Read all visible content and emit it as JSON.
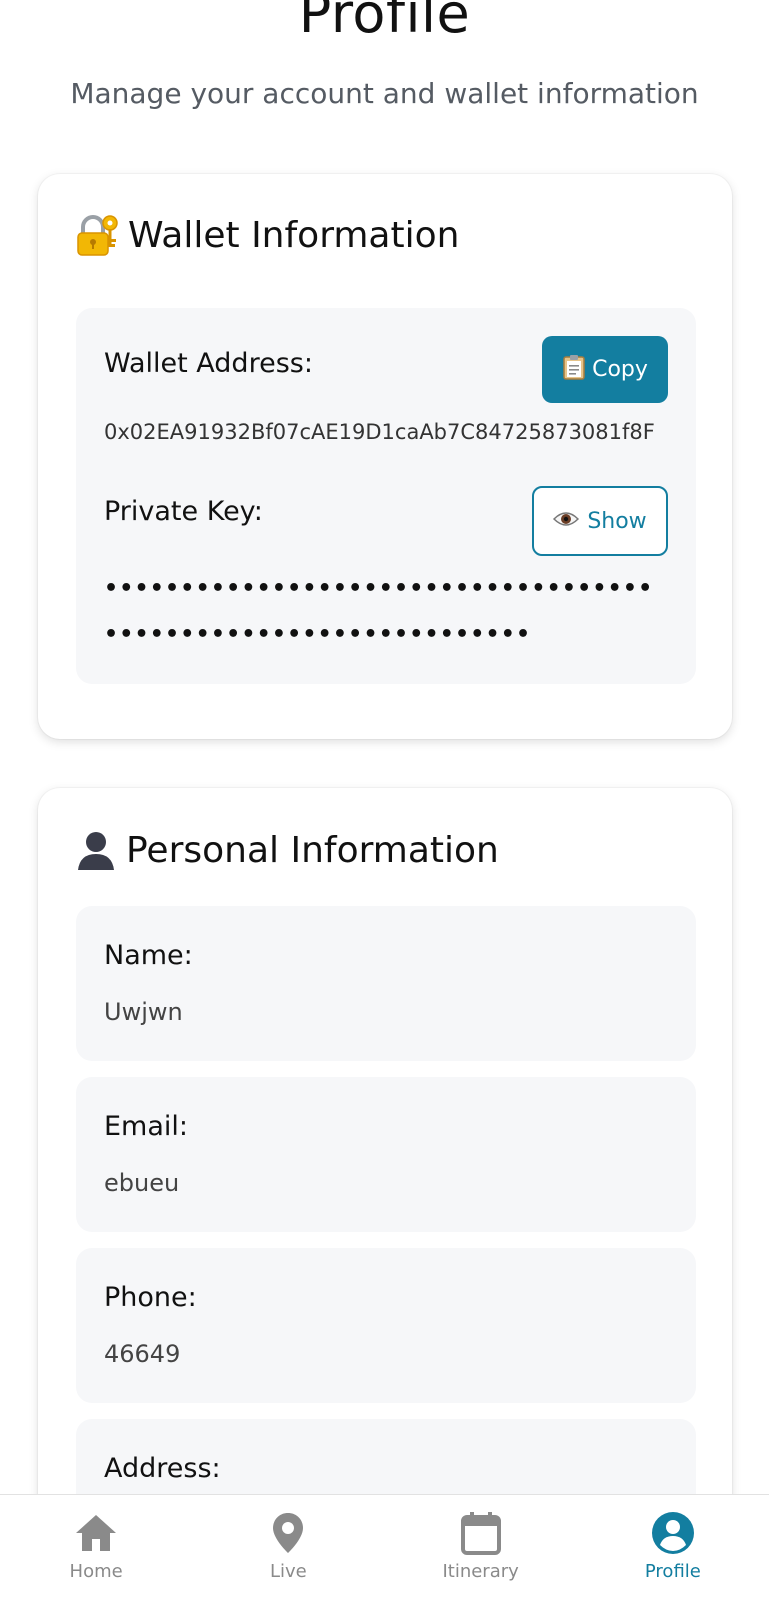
{
  "header": {
    "title": "Profile",
    "subtitle": "Manage your account and wallet information"
  },
  "wallet": {
    "title": "Wallet Information",
    "icon": "lock-with-key-icon",
    "address_label": "Wallet Address:",
    "address_value": "0x02EA91932Bf07cAE19D1caAb7C84725873081f8F",
    "copy_button": "Copy",
    "private_key_label": "Private Key:",
    "show_button": "Show",
    "private_key_masked": "••••••••••••••••••••••••••••••••••••••••••••••••••••••••••••••••"
  },
  "personal": {
    "title": "Personal Information",
    "icon": "person-silhouette-icon",
    "fields": [
      {
        "label": "Name:",
        "value": "Uwjwn"
      },
      {
        "label": "Email:",
        "value": "ebueu"
      },
      {
        "label": "Phone:",
        "value": "46649"
      },
      {
        "label": "Address:",
        "value": ""
      }
    ]
  },
  "nav": {
    "items": [
      {
        "label": "Home",
        "icon": "home-icon"
      },
      {
        "label": "Live",
        "icon": "location-pin-icon"
      },
      {
        "label": "Itinerary",
        "icon": "calendar-icon"
      },
      {
        "label": "Profile",
        "icon": "account-circle-icon",
        "active": true
      }
    ]
  },
  "colors": {
    "accent": "#137ea0",
    "panel_bg": "#f6f7f9",
    "inactive_nav": "#8a8a8a"
  }
}
